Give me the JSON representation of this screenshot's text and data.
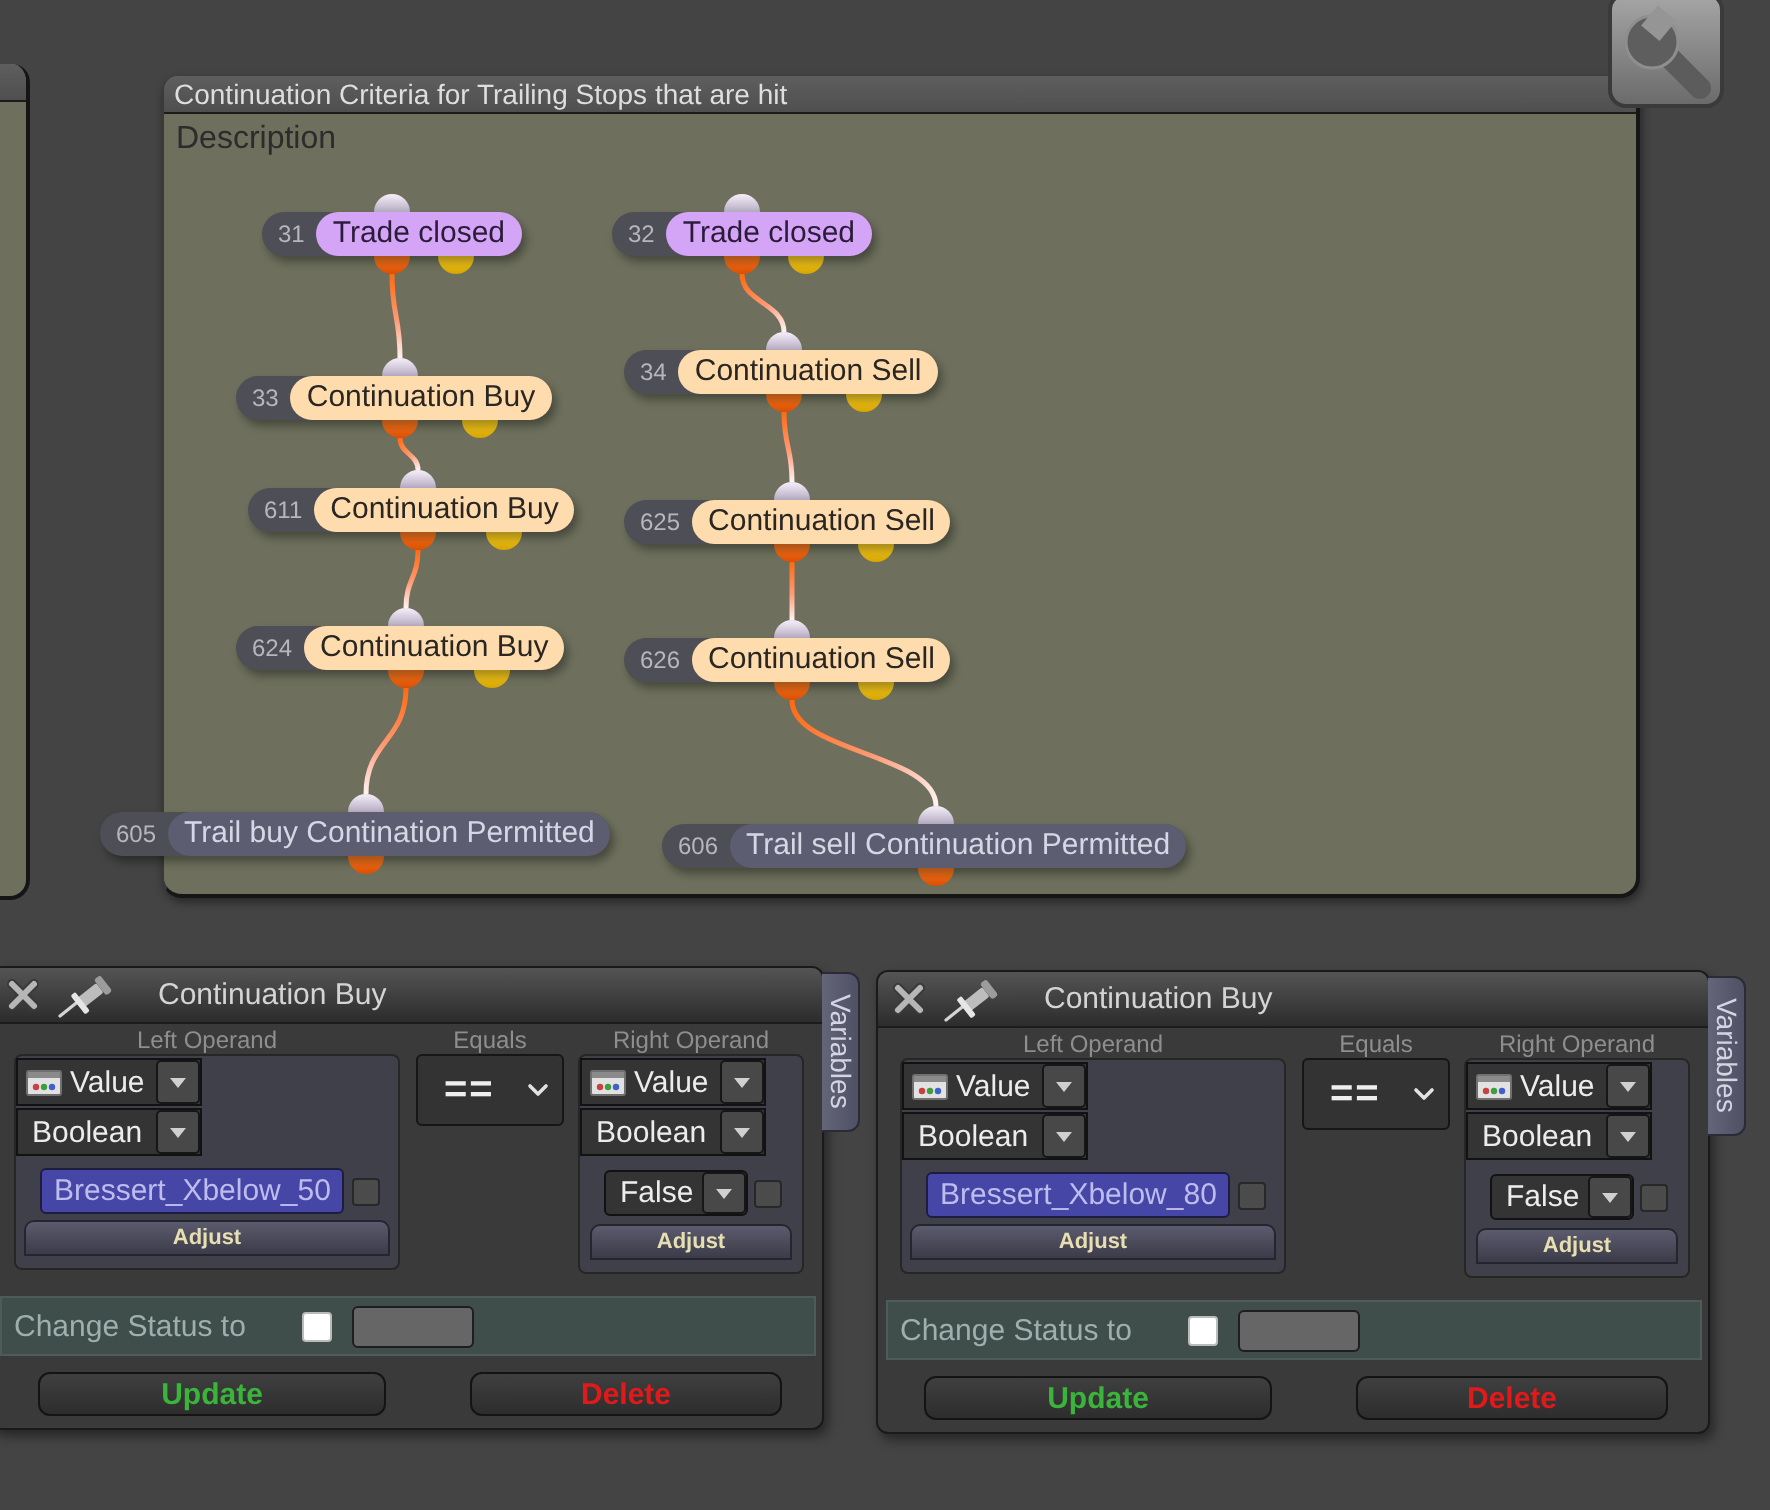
{
  "diagram": {
    "title": "Continuation Criteria for Trailing Stops that are hit",
    "description_label": "Description",
    "flows": [
      {
        "nodes": [
          {
            "id": "31",
            "label": "Trade closed",
            "kind": "trigger"
          },
          {
            "id": "33",
            "label": "Continuation Buy",
            "kind": "condition"
          },
          {
            "id": "611",
            "label": "Continuation Buy",
            "kind": "condition"
          },
          {
            "id": "624",
            "label": "Continuation Buy",
            "kind": "condition"
          },
          {
            "id": "605",
            "label": "Trail buy Contination Permitted",
            "kind": "result"
          }
        ]
      },
      {
        "nodes": [
          {
            "id": "32",
            "label": "Trade closed",
            "kind": "trigger"
          },
          {
            "id": "34",
            "label": "Continuation Sell",
            "kind": "condition"
          },
          {
            "id": "625",
            "label": "Continuation Sell",
            "kind": "condition"
          },
          {
            "id": "626",
            "label": "Continuation Sell",
            "kind": "condition"
          },
          {
            "id": "606",
            "label": "Trail sell Continuation Permitted",
            "kind": "result"
          }
        ]
      }
    ]
  },
  "editors": [
    {
      "title": "Continuation Buy",
      "side_tab": "Variables",
      "left_operand": {
        "heading": "Left Operand",
        "source": "Value",
        "data_type": "Boolean",
        "kind": "variable",
        "value": "Bressert_Xbelow_50",
        "checked": false,
        "adjust": "Adjust"
      },
      "comparison": {
        "heading": "Equals",
        "operator": "=="
      },
      "right_operand": {
        "heading": "Right Operand",
        "source": "Value",
        "data_type": "Boolean",
        "kind": "constant",
        "value": "False",
        "checked": false,
        "adjust": "Adjust"
      },
      "change_status": {
        "label": "Change Status to",
        "checked": false
      },
      "buttons": [
        {
          "label": "Update",
          "kind": "update"
        },
        {
          "label": "Delete",
          "kind": "delete"
        }
      ]
    },
    {
      "title": "Continuation Buy",
      "side_tab": "Variables",
      "left_operand": {
        "heading": "Left Operand",
        "source": "Value",
        "data_type": "Boolean",
        "kind": "variable",
        "value": "Bressert_Xbelow_80",
        "checked": false,
        "adjust": "Adjust"
      },
      "comparison": {
        "heading": "Equals",
        "operator": "=="
      },
      "right_operand": {
        "heading": "Right Operand",
        "source": "Value",
        "data_type": "Boolean",
        "kind": "constant",
        "value": "False",
        "checked": false,
        "adjust": "Adjust"
      },
      "change_status": {
        "label": "Change Status to",
        "checked": false
      },
      "buttons": [
        {
          "label": "Update",
          "kind": "update"
        },
        {
          "label": "Delete",
          "kind": "delete"
        }
      ]
    }
  ]
}
